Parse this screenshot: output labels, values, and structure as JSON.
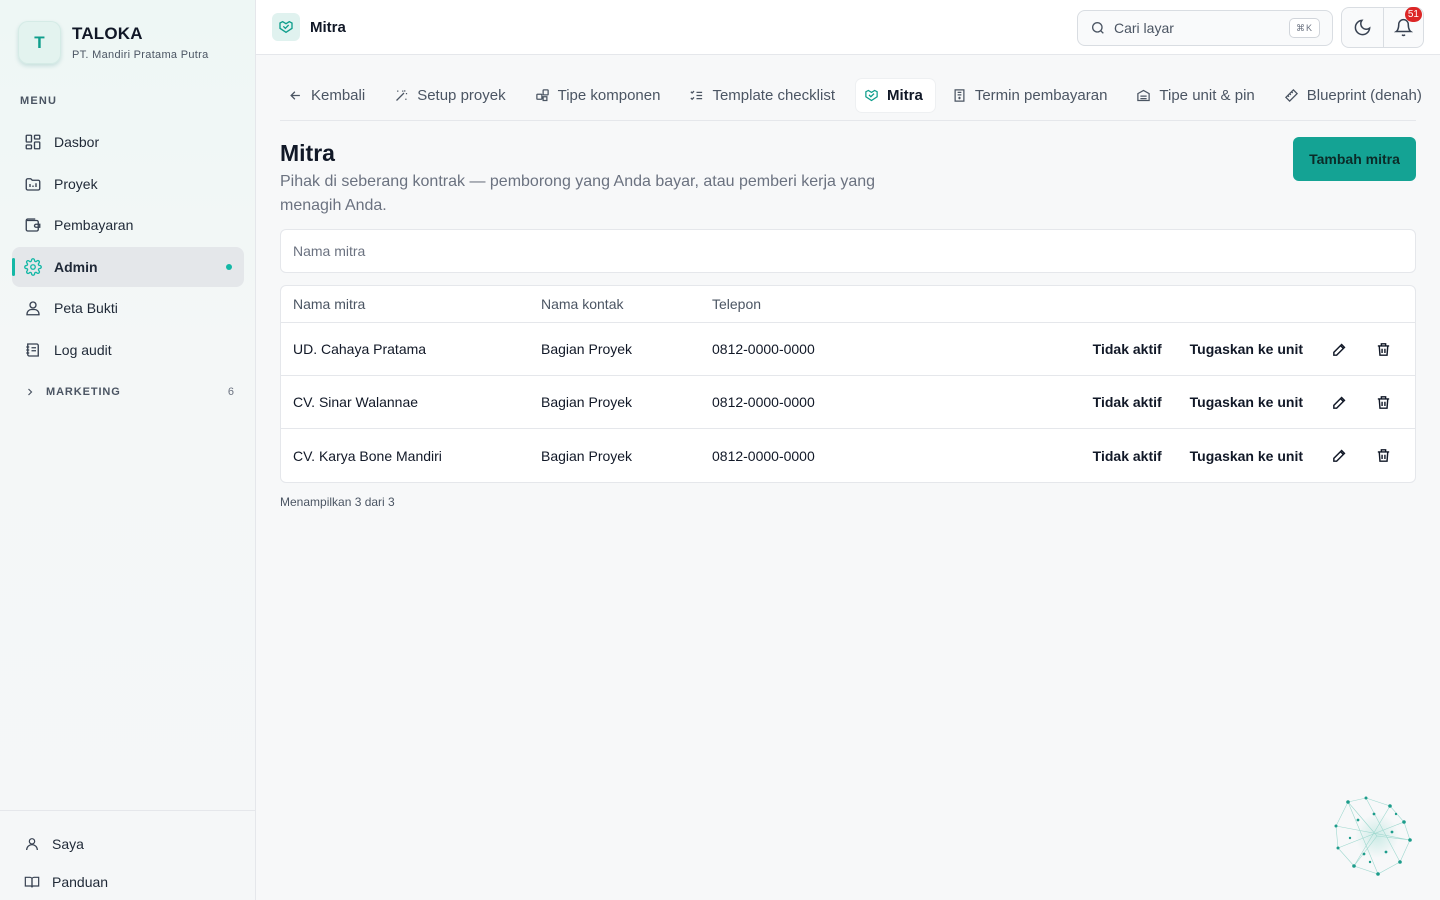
{
  "brand": {
    "initial": "T",
    "name": "TALOKA",
    "company": "PT. Mandiri Pratama Putra"
  },
  "sidebar": {
    "menu_label": "MENU",
    "items": [
      {
        "label": "Dasbor",
        "icon": "dashboard-icon"
      },
      {
        "label": "Proyek",
        "icon": "folder-icon"
      },
      {
        "label": "Pembayaran",
        "icon": "wallet-icon"
      },
      {
        "label": "Admin",
        "icon": "gear-icon",
        "active": true
      },
      {
        "label": "Peta Bukti",
        "icon": "user-pin-icon"
      },
      {
        "label": "Log audit",
        "icon": "audit-log-icon"
      }
    ],
    "group": {
      "label": "MARKETING",
      "count": "6"
    },
    "bottom": [
      {
        "label": "Saya",
        "icon": "user-icon"
      },
      {
        "label": "Panduan",
        "icon": "book-icon"
      }
    ]
  },
  "header": {
    "page_title": "Mitra",
    "search_placeholder": "Cari layar",
    "search_shortcut": "⌘K",
    "notification_count": "51"
  },
  "tabs": [
    {
      "label": "Kembali",
      "icon": "arrow-left-icon"
    },
    {
      "label": "Setup proyek",
      "icon": "magic-wand-icon"
    },
    {
      "label": "Tipe komponen",
      "icon": "puzzle-icon"
    },
    {
      "label": "Template checklist",
      "icon": "checklist-icon"
    },
    {
      "label": "Mitra",
      "icon": "handshake-icon",
      "active": true
    },
    {
      "label": "Termin pembayaran",
      "icon": "receipt-icon"
    },
    {
      "label": "Tipe unit & pin",
      "icon": "building-icon"
    },
    {
      "label": "Blueprint (denah)",
      "icon": "ruler-icon"
    }
  ],
  "main": {
    "title": "Mitra",
    "description": "Pihak di seberang kontrak — pemborong yang Anda bayar, atau pemberi kerja yang menagih Anda.",
    "add_button": "Tambah mitra",
    "filter_placeholder": "Nama mitra",
    "columns": [
      "Nama mitra",
      "Nama kontak",
      "Telepon"
    ],
    "rows": [
      {
        "name": "UD. Cahaya Pratama",
        "contact": "Bagian Proyek",
        "phone": "0812-0000-0000",
        "status_action": "Tidak aktif",
        "assign_action": "Tugaskan ke unit"
      },
      {
        "name": "CV. Sinar Walannae",
        "contact": "Bagian Proyek",
        "phone": "0812-0000-0000",
        "status_action": "Tidak aktif",
        "assign_action": "Tugaskan ke unit"
      },
      {
        "name": "CV. Karya Bone Mandiri",
        "contact": "Bagian Proyek",
        "phone": "0812-0000-0000",
        "status_action": "Tidak aktif",
        "assign_action": "Tugaskan ke unit"
      }
    ],
    "footer": "Menampilkan 3 dari 3"
  },
  "colors": {
    "accent": "#14a394",
    "accent_dark": "#0f9e8c",
    "badge": "#dc2626"
  }
}
